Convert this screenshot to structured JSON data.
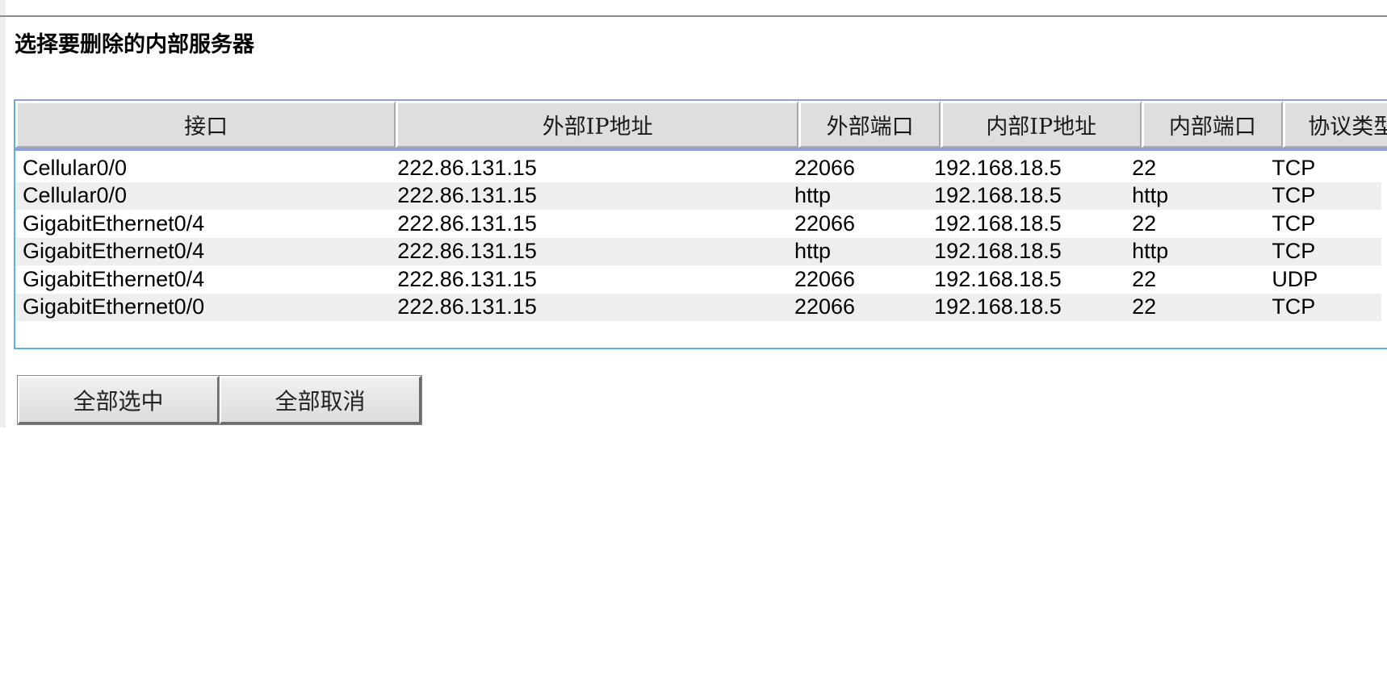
{
  "page": {
    "title": "选择要删除的内部服务器"
  },
  "table": {
    "headers": [
      "接口",
      "外部IP地址",
      "外部端口",
      "内部IP地址",
      "内部端口",
      "协议类型"
    ],
    "rows": [
      [
        "Cellular0/0",
        "222.86.131.15",
        "22066",
        "192.168.18.5",
        "22",
        "TCP"
      ],
      [
        "Cellular0/0",
        "222.86.131.15",
        "http",
        "192.168.18.5",
        "http",
        "TCP"
      ],
      [
        "GigabitEthernet0/4",
        "222.86.131.15",
        "22066",
        "192.168.18.5",
        "22",
        "TCP"
      ],
      [
        "GigabitEthernet0/4",
        "222.86.131.15",
        "http",
        "192.168.18.5",
        "http",
        "TCP"
      ],
      [
        "GigabitEthernet0/4",
        "222.86.131.15",
        "22066",
        "192.168.18.5",
        "22",
        "UDP"
      ],
      [
        "GigabitEthernet0/0",
        "222.86.131.15",
        "22066",
        "192.168.18.5",
        "22",
        "TCP"
      ]
    ]
  },
  "buttons": {
    "select_all": "全部选中",
    "deselect_all": "全部取消"
  },
  "colors": {
    "frame_border": "#5fb0dc",
    "header_bg": "#dedede",
    "alt_row_bg": "#eeeeee"
  }
}
